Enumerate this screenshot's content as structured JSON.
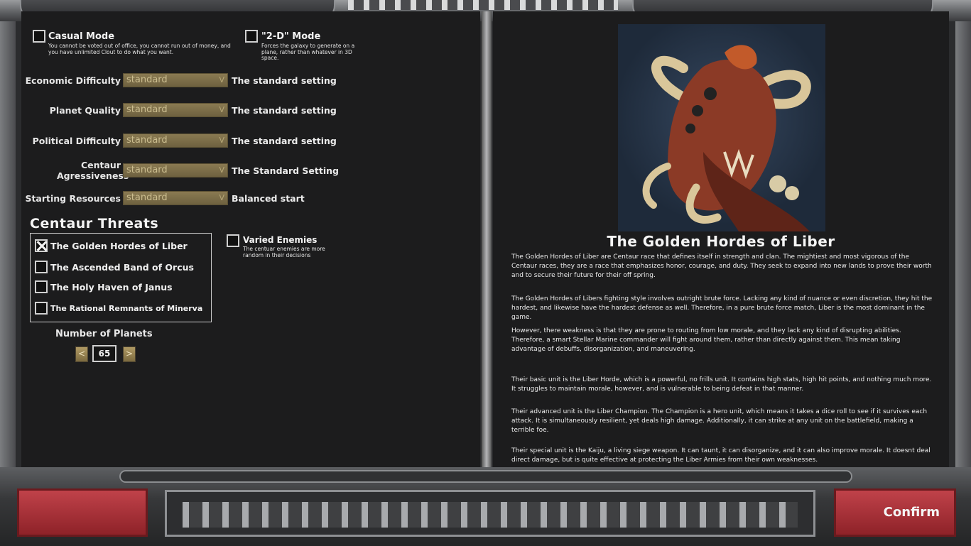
{
  "settings": {
    "casual_mode": {
      "title": "Casual Mode",
      "desc": "You cannot be voted out of office, you cannot run out of money, and you have unlimited Clout to do what you want.",
      "checked": false
    },
    "two_d_mode": {
      "title": "\"2-D\" Mode",
      "desc": "Forces the galaxy to generate on a plane, rather than whatever in 3D space.",
      "checked": false
    },
    "rows": [
      {
        "label": "Economic Difficulty",
        "value": "standard",
        "note": "The standard setting"
      },
      {
        "label": "Planet Quality",
        "value": "standard",
        "note": "The standard setting"
      },
      {
        "label": "Political Difficulty",
        "value": "standard",
        "note": "The standard setting"
      },
      {
        "label": "Centaur Agressiveness",
        "value": "standard",
        "note": "The Standard Setting"
      },
      {
        "label": "Starting Resources",
        "value": "standard",
        "note": "Balanced start"
      }
    ],
    "threats_title": "Centaur Threats",
    "threats": [
      {
        "label": "The Golden Hordes of Liber",
        "checked": true
      },
      {
        "label": "The Ascended Band of Orcus",
        "checked": false
      },
      {
        "label": "The Holy Haven of Janus",
        "checked": false
      },
      {
        "label": "The Rational Remnants of Minerva",
        "checked": false
      }
    ],
    "varied_enemies": {
      "title": "Varied Enemies",
      "desc": "The centuar enemies are more random in their decisions",
      "checked": false
    },
    "planets": {
      "label": "Number of Planets",
      "value": "65",
      "dec": "<",
      "inc": ">"
    }
  },
  "faction": {
    "name": "The Golden Hordes of Liber",
    "paragraphs": [
      "The Golden Hordes of Liber are Centaur race that defines itself in strength and clan. The mightiest and most vigorous of the Centaur races, they are a race that emphasizes honor, courage, and duty. They seek to expand into new lands to prove their worth and to secure their future for their off spring.",
      "The Golden Hordes of Libers fighting style involves outright brute force. Lacking any kind of nuance or even discretion, they hit the hardest, and likewise have the hardest defense as well. Therefore, in a pure brute force match, Liber is the most dominant in the game.",
      "However, there weakness is that they are prone to routing from low morale, and they lack any kind of disrupting abilities. Therefore, a smart Stellar Marine commander will fight around them, rather than directly against them. This mean taking advantage of debuffs, disorganization, and maneuvering.",
      "Their basic unit is the Liber Horde, which is a powerful, no frills unit. It contains high stats, high hit points, and nothing much more. It struggles to maintain morale, however, and is vulnerable to being defeat in that manner.",
      "Their advanced unit is the Liber Champion. The Champion is a hero unit, which means it takes a dice roll to see if it survives each attack. It is simultaneously resilient, yet deals high damage. Additionally, it can strike at any unit on the battlefield, making a terrible foe.",
      "Their special unit is the Kaiju, a living siege weapon. It can taunt, it can disorganize, and it can also improve morale. It doesnt deal direct damage, but is quite effective at protecting the Liber Armies from their own weaknesses."
    ]
  },
  "footer": {
    "confirm": "Confirm"
  },
  "colors": {
    "accent_gold": "#8a7a52",
    "confirm_red": "#b0353c",
    "panel_bg": "#1c1c1d"
  },
  "icons": {
    "checkbox_checked": "x-mark",
    "select": "chevron-down",
    "portrait": "centaur-beast-portrait"
  }
}
